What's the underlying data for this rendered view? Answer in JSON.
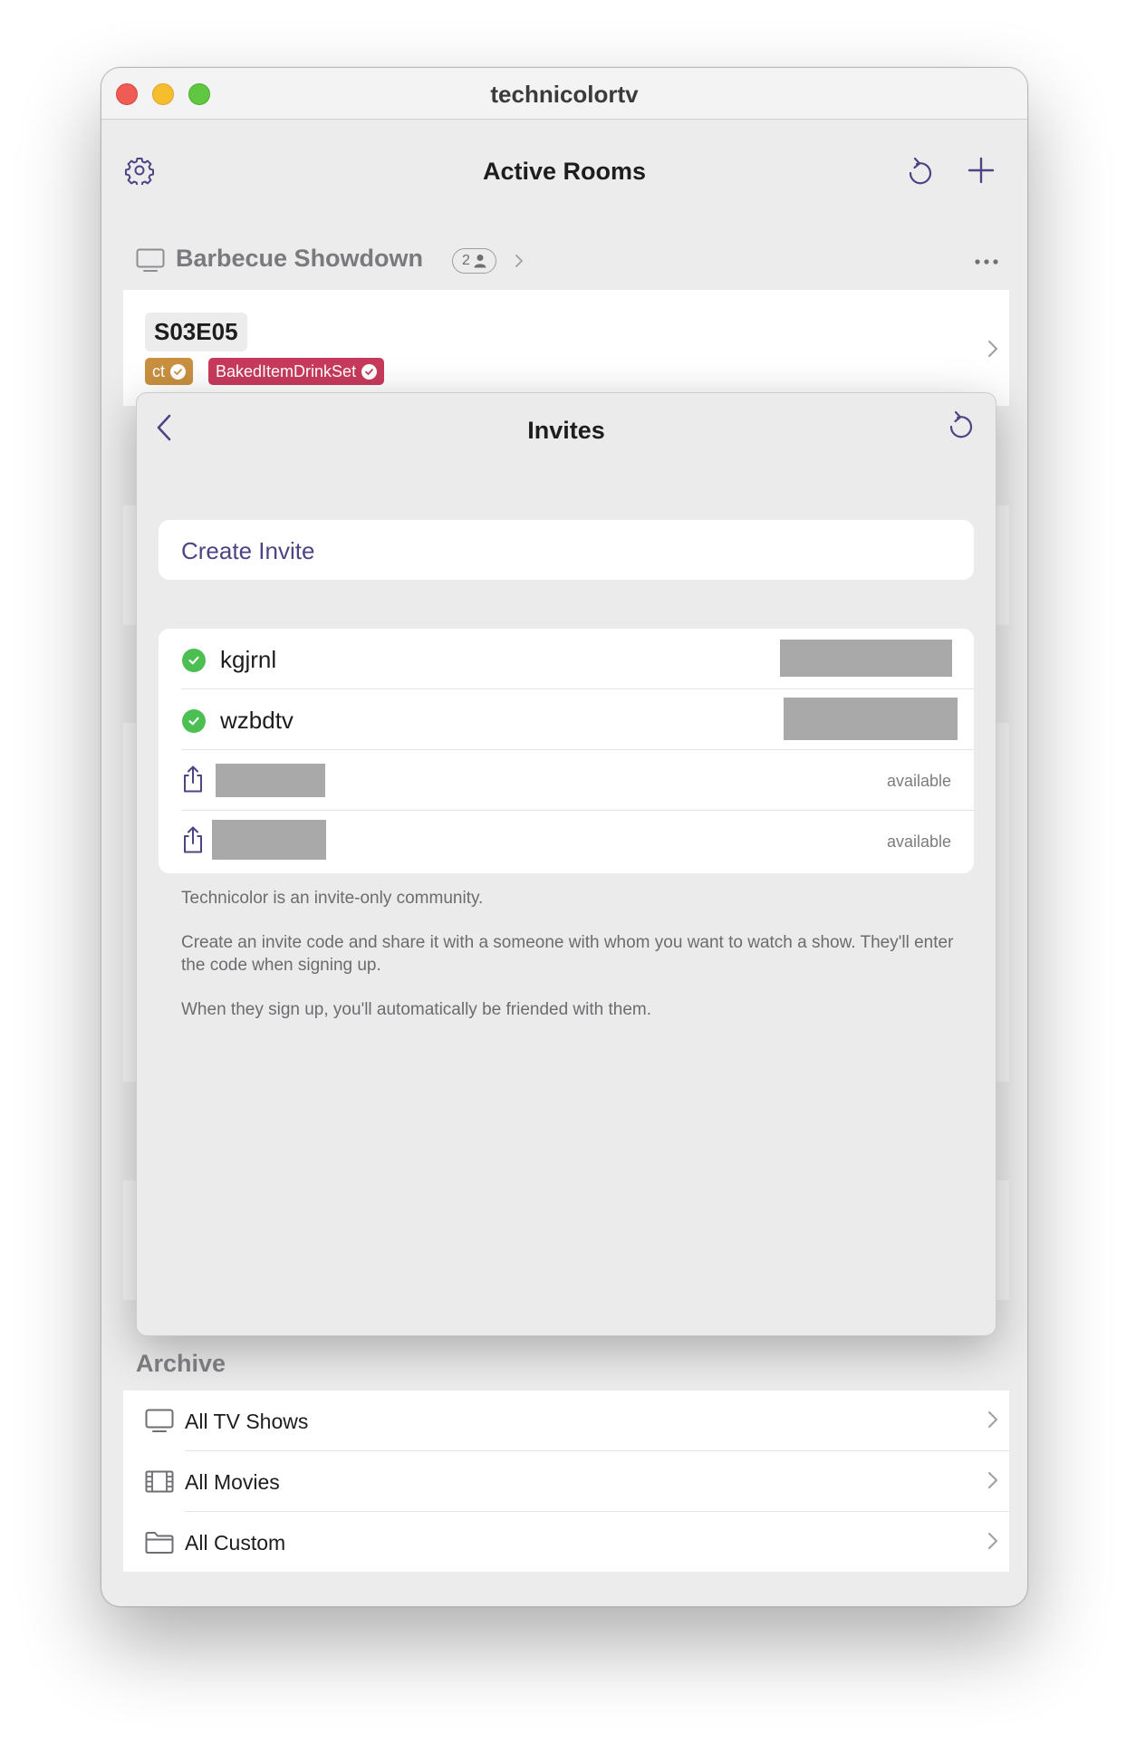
{
  "window": {
    "title": "technicolortv"
  },
  "nav": {
    "title": "Active Rooms"
  },
  "room": {
    "name": "Barbecue Showdown",
    "member_count": "2"
  },
  "episode": {
    "code": "S03E05",
    "tags": [
      {
        "label": "ct",
        "color": "#c89040"
      },
      {
        "label": "BakedItemDrinkSet",
        "color": "#c73a5c"
      }
    ]
  },
  "invites_sheet": {
    "title": "Invites",
    "create_label": "Create Invite",
    "invites": [
      {
        "code": "kgjrnl",
        "status": "used"
      },
      {
        "code": "wzbdtv",
        "status": "used"
      },
      {
        "status": "available",
        "status_label": "available"
      },
      {
        "status": "available",
        "status_label": "available"
      }
    ],
    "footer": {
      "line1": "Technicolor is an invite-only community.",
      "line2": "Create an invite code and share it with a someone with whom you want to watch a show. They'll enter the code when signing up.",
      "line3": "When they sign up, you'll automatically be friended with them."
    }
  },
  "archive": {
    "title": "Archive",
    "items": [
      {
        "label": "All TV Shows",
        "icon": "tv-icon"
      },
      {
        "label": "All Movies",
        "icon": "film-icon"
      },
      {
        "label": "All Custom",
        "icon": "folder-icon"
      }
    ]
  },
  "colors": {
    "accent": "#4e4485",
    "success": "#4cbf53",
    "tag_gold": "#c89040",
    "tag_red": "#c73a5c"
  }
}
